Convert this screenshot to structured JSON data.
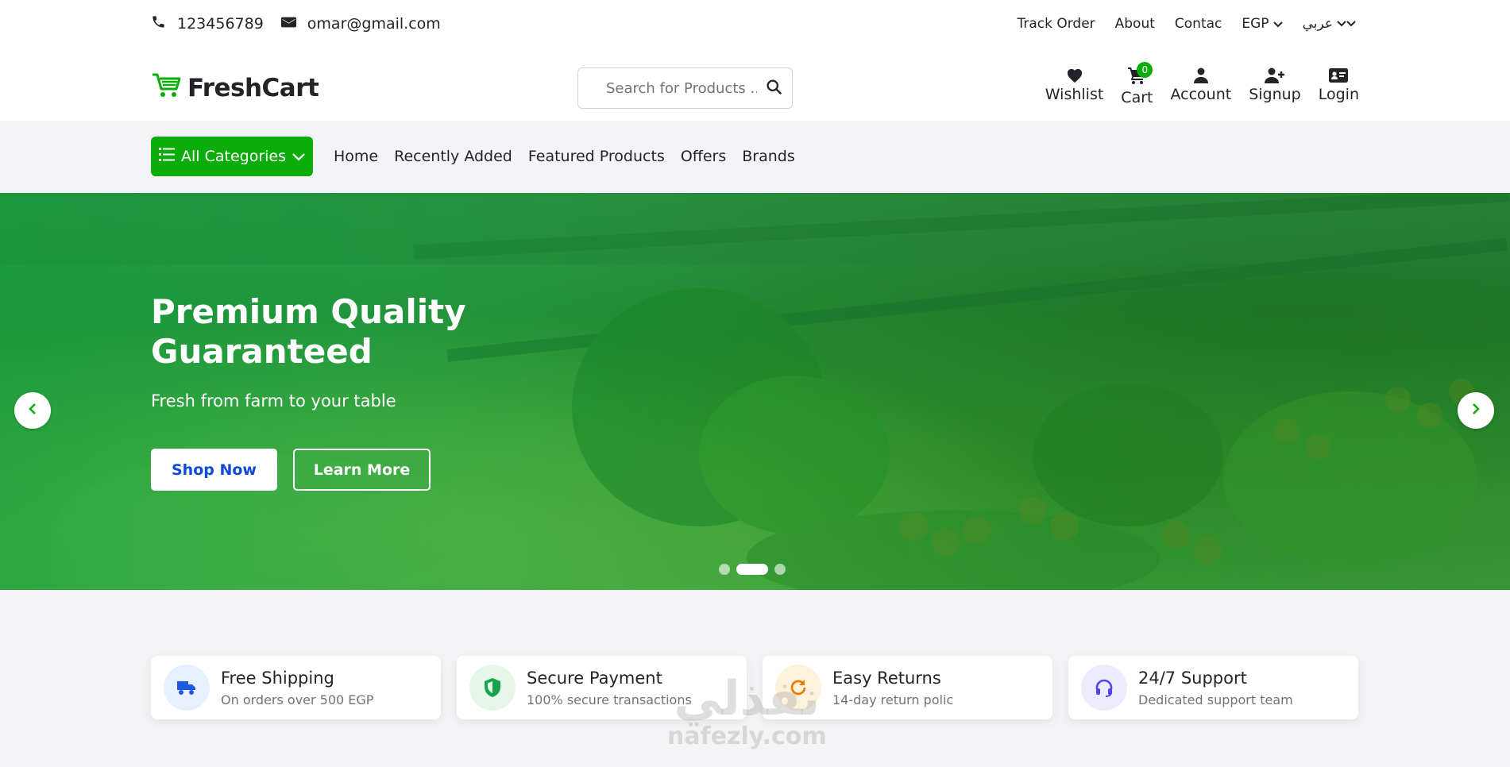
{
  "topbar": {
    "phone": "123456789",
    "email": "omar@gmail.com",
    "links": [
      "Track Order",
      "About",
      "Contac"
    ],
    "currency": "EGP",
    "language": "عربي"
  },
  "header": {
    "logo_text": "FreshCart",
    "search_placeholder": "Search for Products ...",
    "actions": {
      "wishlist": "Wishlist",
      "cart": "Cart",
      "cart_count": "0",
      "account": "Account",
      "signup": "Signup",
      "login": "Login"
    }
  },
  "nav": {
    "all_categories": "All Categories",
    "links": [
      "Home",
      "Recently Added",
      "Featured Products",
      "Offers",
      "Brands"
    ]
  },
  "hero": {
    "title": "Premium Quality Guaranteed",
    "subtitle": "Fresh from farm to your table",
    "shop_now": "Shop Now",
    "learn_more": "Learn More",
    "slides_total": 3,
    "active_slide": 2
  },
  "features": [
    {
      "title": "Free Shipping",
      "desc": "On orders over 500 EGP",
      "icon": "truck-icon",
      "bg": "#e7f0ff",
      "color": "#1e5adf"
    },
    {
      "title": "Secure Payment",
      "desc": "100% secure transactions",
      "icon": "shield-icon",
      "bg": "#e6f7ea",
      "color": "#16a34a"
    },
    {
      "title": "Easy Returns",
      "desc": "14-day return polic",
      "icon": "refresh-icon",
      "bg": "#fdf3dc",
      "color": "#ea7a0c"
    },
    {
      "title": "24/7 Support",
      "desc": "Dedicated support team",
      "icon": "headset-icon",
      "bg": "#ecebff",
      "color": "#4f46e5"
    }
  ],
  "watermark": {
    "line1": "نفذلي",
    "line2": "nafezly.com"
  },
  "colors": {
    "accent": "#0aad0a",
    "shop_now_text": "#0d4bd6"
  }
}
